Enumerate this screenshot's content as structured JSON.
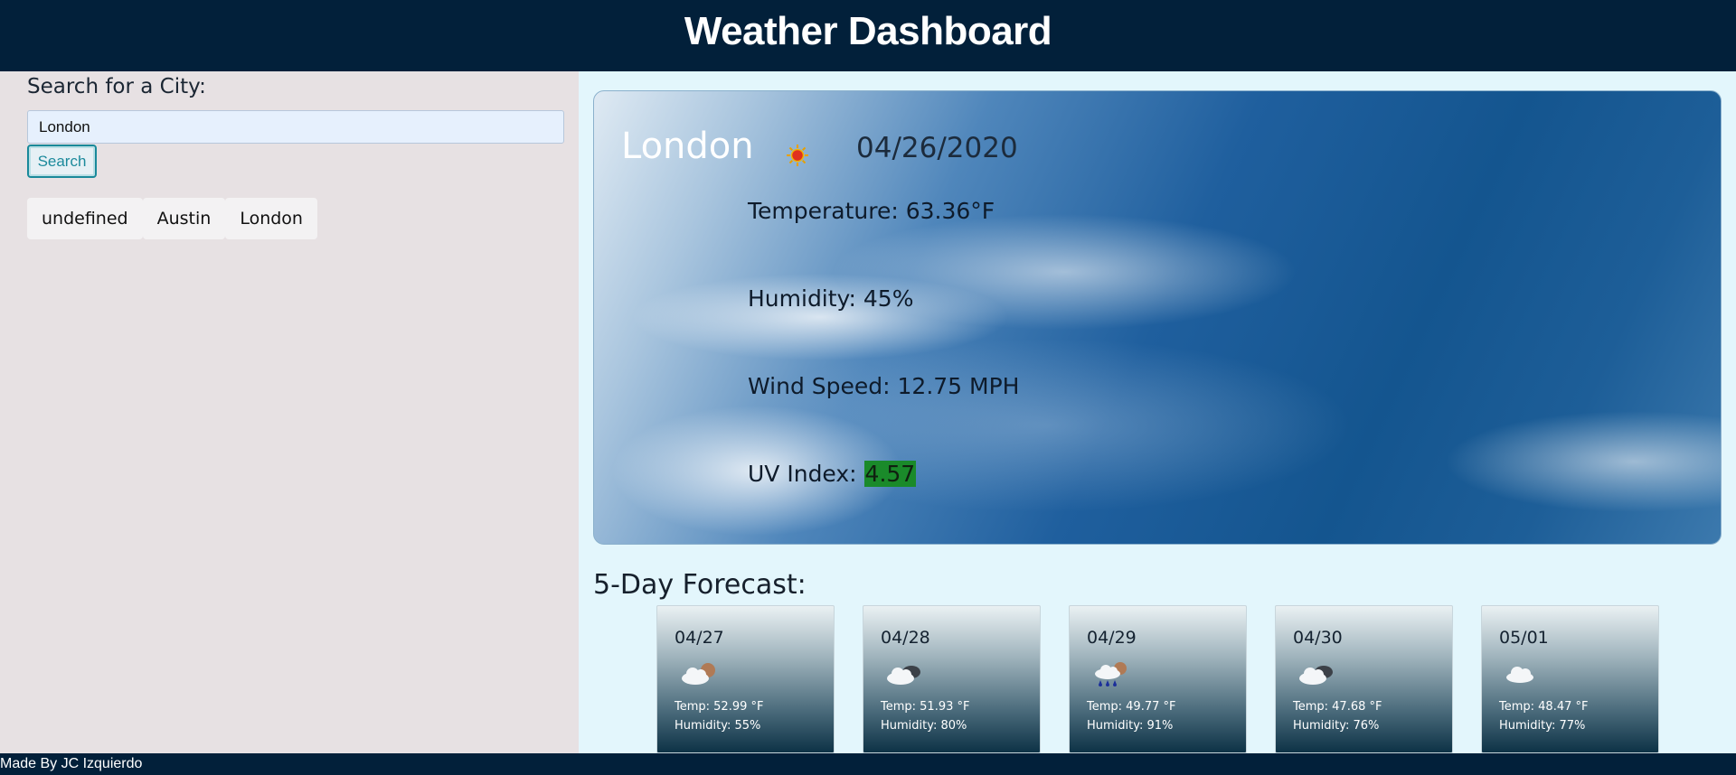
{
  "header": {
    "title": "Weather Dashboard"
  },
  "sidebar": {
    "search_label": "Search for a City:",
    "search_value": "London",
    "search_button": "Search",
    "history": [
      "undefined",
      "Austin",
      "London"
    ]
  },
  "current": {
    "city": "London",
    "icon": "sun-icon",
    "date": "04/26/2020",
    "temperature": "Temperature: 63.36°F",
    "humidity": "Humidity: 45%",
    "wind": "Wind Speed: 12.75 MPH",
    "uv_label": "UV Index: ",
    "uv_value": "4.57",
    "uv_color": "#1a8a2a"
  },
  "forecast": {
    "title": "5-Day Forecast:",
    "days": [
      {
        "date": "04/27",
        "icon": "cloud-sun-icon",
        "temp": "Temp: 52.99 °F",
        "humidity": "Humidity: 55%"
      },
      {
        "date": "04/28",
        "icon": "cloud-dark-icon",
        "temp": "Temp: 51.93 °F",
        "humidity": "Humidity: 80%"
      },
      {
        "date": "04/29",
        "icon": "rain-cloud-icon",
        "temp": "Temp: 49.77 °F",
        "humidity": "Humidity: 91%"
      },
      {
        "date": "04/30",
        "icon": "cloud-dark-icon",
        "temp": "Temp: 47.68 °F",
        "humidity": "Humidity: 76%"
      },
      {
        "date": "05/01",
        "icon": "cloud-icon",
        "temp": "Temp: 48.47 °F",
        "humidity": "Humidity: 77%"
      }
    ]
  },
  "footer": {
    "text": "Made By JC Izquierdo"
  }
}
